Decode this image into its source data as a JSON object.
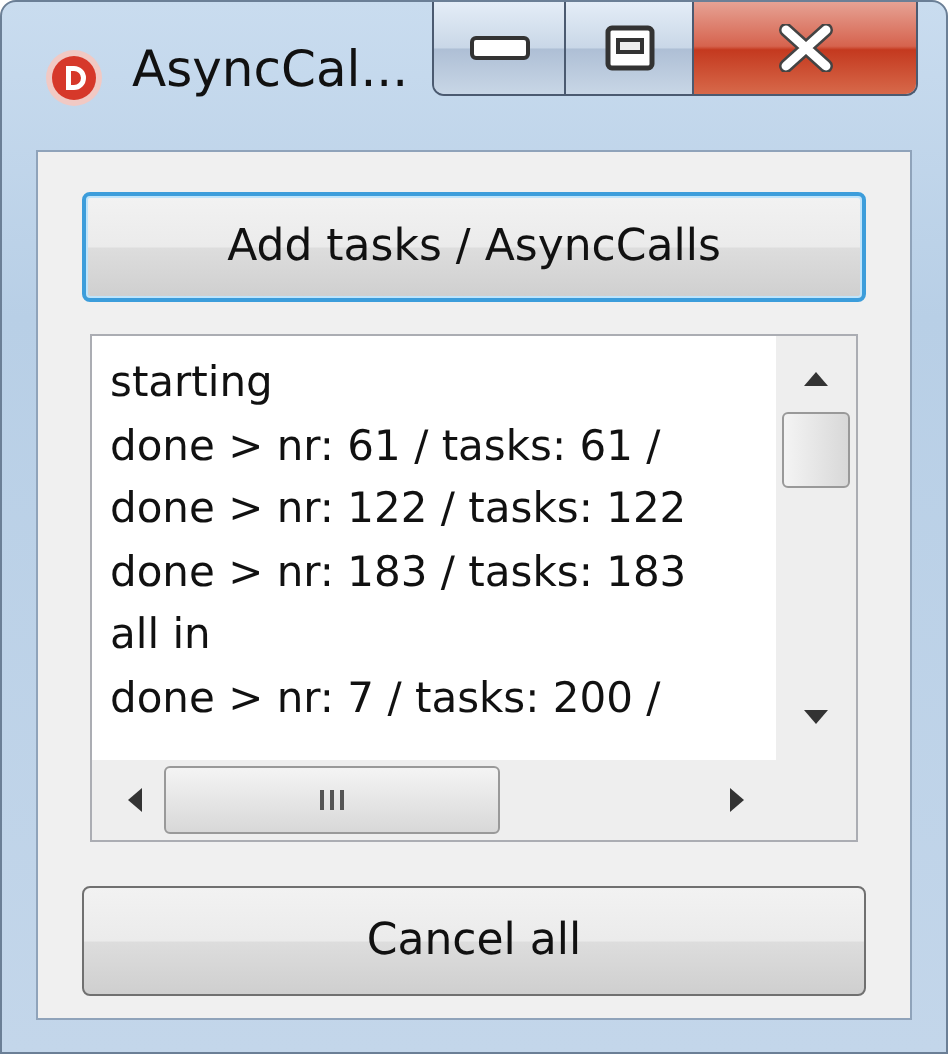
{
  "window": {
    "title": "AsyncCal..."
  },
  "add_button": {
    "label": "Add tasks / AsyncCalls",
    "focused": true
  },
  "log": {
    "lines": [
      "starting",
      "done > nr: 61 / tasks: 61 /",
      "done > nr: 122 / tasks: 122",
      "done > nr: 183 / tasks: 183",
      "all in",
      "done > nr: 7 / tasks: 200 /"
    ]
  },
  "cancel_button": {
    "label": "Cancel all",
    "focused": false
  }
}
